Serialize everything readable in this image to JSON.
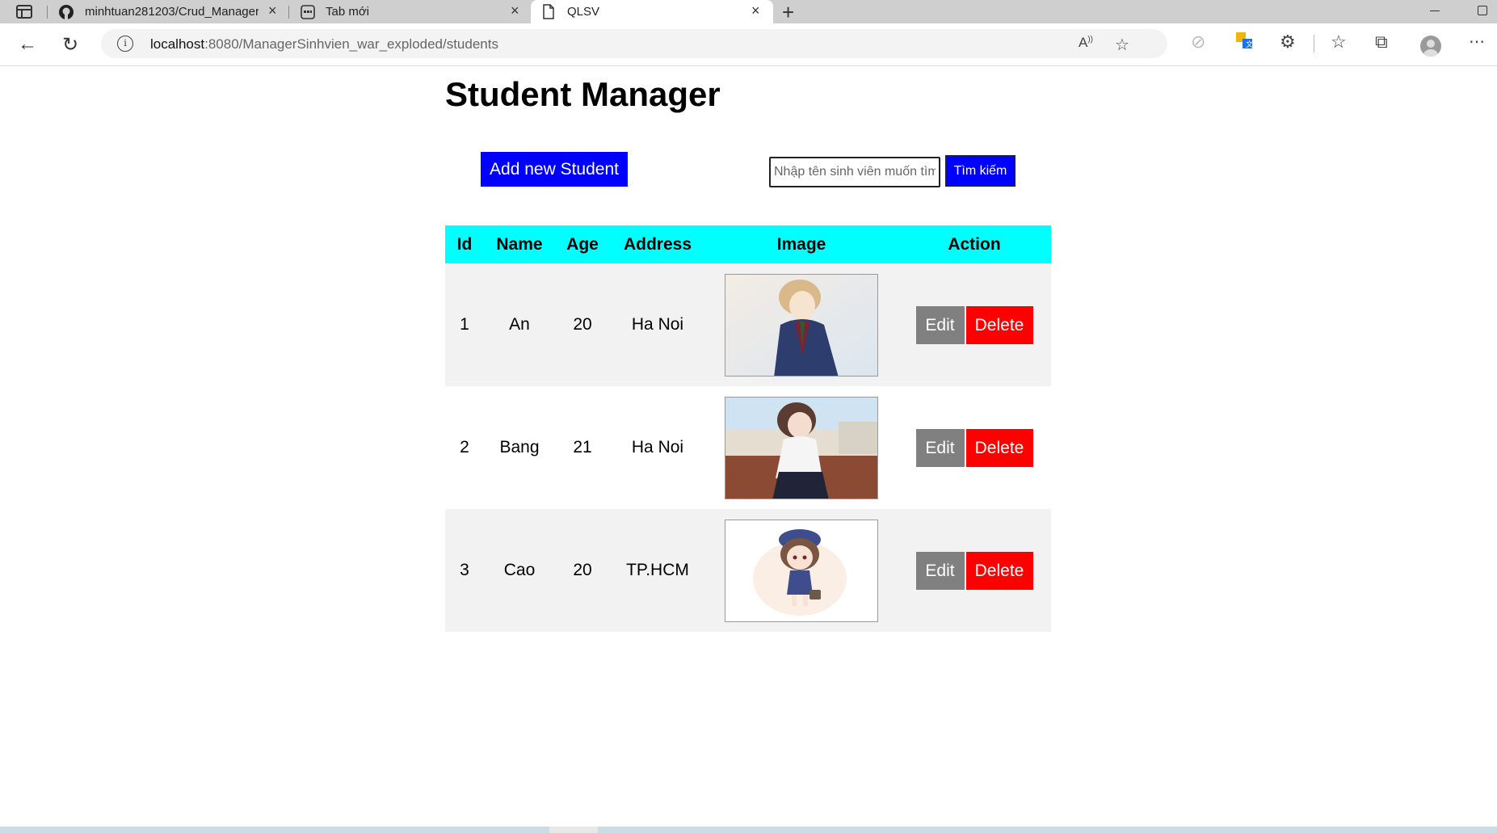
{
  "browser": {
    "tabs": [
      {
        "title": "minhtuan281203/Crud_Manager",
        "icon": "github-icon"
      },
      {
        "title": "Tab mới",
        "icon": "newtab-icon"
      },
      {
        "title": "QLSV",
        "icon": "page-icon",
        "active": true
      }
    ],
    "url_host": "localhost",
    "url_path": ":8080/ManagerSinhvien_war_exploded/students"
  },
  "page": {
    "title": "Student Manager",
    "add_button": "Add new Student",
    "search_placeholder": "Nhập tên sinh viên muốn tìm",
    "search_button": "Tìm kiếm"
  },
  "table": {
    "headers": [
      "Id",
      "Name",
      "Age",
      "Address",
      "Image",
      "Action"
    ],
    "rows": [
      {
        "id": "1",
        "name": "An",
        "age": "20",
        "address": "Ha Noi",
        "image": "anime-boy-suit",
        "edit": "Edit",
        "delete": "Delete"
      },
      {
        "id": "2",
        "name": "Bang",
        "age": "21",
        "address": "Ha Noi",
        "image": "anime-girl-school",
        "edit": "Edit",
        "delete": "Delete"
      },
      {
        "id": "3",
        "name": "Cao",
        "age": "20",
        "address": "TP.HCM",
        "image": "chibi-girl-hat",
        "edit": "Edit",
        "delete": "Delete"
      }
    ]
  },
  "colors": {
    "accent_blue": "#0000ff",
    "header_cyan": "#00ffff",
    "edit_gray": "#808080",
    "delete_red": "#ff0000"
  }
}
